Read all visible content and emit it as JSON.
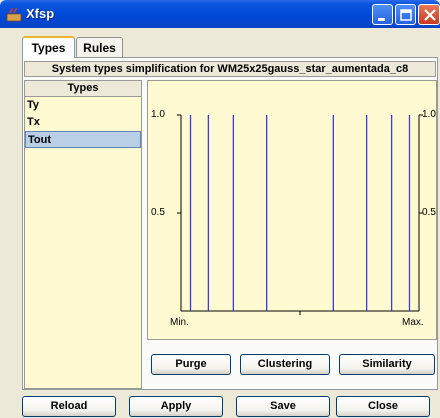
{
  "window": {
    "title": "Xfsp"
  },
  "tabs": [
    {
      "label": "Types",
      "active": true
    },
    {
      "label": "Rules",
      "active": false
    }
  ],
  "subtitle": "System types simplification for WM25x25gauss_star_aumentada_c8",
  "types_panel": {
    "header": "Types",
    "items": [
      {
        "label": "Ty",
        "selected": false
      },
      {
        "label": "Tx",
        "selected": false
      },
      {
        "label": "Tout",
        "selected": true
      }
    ]
  },
  "plot": {
    "y_ticks": [
      "1.0",
      "0.5"
    ],
    "x_min_label": "Min.",
    "x_max_label": "Max.",
    "line_color": "#3b3bd8",
    "membership_positions": [
      0.04,
      0.115,
      0.22,
      0.36,
      0.64,
      0.78,
      0.885,
      0.96
    ]
  },
  "panel_buttons": {
    "purge": "Purge",
    "clustering": "Clustering",
    "similarity": "Similarity"
  },
  "footer_buttons": {
    "reload": "Reload",
    "apply": "Apply",
    "save": "Save",
    "close": "Close"
  }
}
